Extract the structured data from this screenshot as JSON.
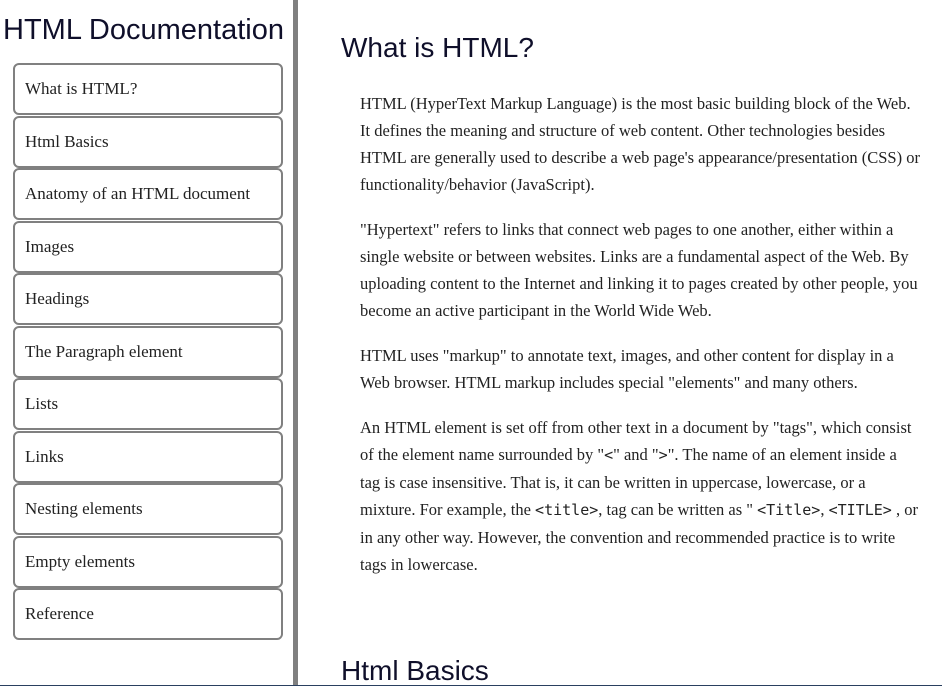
{
  "nav": {
    "title": "HTML Documentation",
    "items": [
      "What is HTML?",
      "Html Basics",
      "Anatomy of an HTML document",
      "Images",
      "Headings",
      "The Paragraph element",
      "Lists",
      "Links",
      "Nesting elements",
      "Empty elements",
      "Reference"
    ]
  },
  "main": {
    "section1": {
      "heading": "What is HTML?",
      "p1": "HTML (HyperText Markup Language) is the most basic building block of the Web. It defines the meaning and structure of web content. Other technologies besides HTML are generally used to describe a web page's appearance/presentation (CSS) or functionality/behavior (JavaScript).",
      "p2": "\"Hypertext\" refers to links that connect web pages to one another, either within a single website or between websites. Links are a fundamental aspect of the Web. By uploading content to the Internet and linking it to pages created by other people, you become an active participant in the World Wide Web.",
      "p3": "HTML uses \"markup\" to annotate text, images, and other content for display in a Web browser. HTML markup includes special \"elements\" and many others.",
      "p4": {
        "t1": "An HTML element is set off from other text in a document by \"tags\", which consist of the element name surrounded by \"",
        "c1": "<",
        "t2": "\" and \"",
        "c2": ">",
        "t3": "\". The name of an element inside a tag is case insensitive. That is, it can be written in uppercase, lowercase, or a mixture. For example, the ",
        "c3": "<title>",
        "t4": ", tag can be written as \" ",
        "c4": "<Title>",
        "t5": ", ",
        "c5": "<TITLE>",
        "t6": " , or in any other way. However, the convention and recommended practice is to write tags in lowercase."
      }
    },
    "section2": {
      "heading": "Html Basics"
    }
  }
}
